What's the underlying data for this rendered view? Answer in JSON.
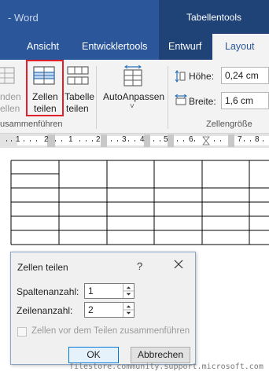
{
  "window": {
    "title": "- Word",
    "context_group": "Tabellentools"
  },
  "tabs": [
    {
      "label": "Ansicht"
    },
    {
      "label": "Entwicklertools"
    },
    {
      "label": "Entwurf"
    },
    {
      "label": "Layout",
      "active": true
    }
  ],
  "ribbon": {
    "merge_group": {
      "partial_button_line1": "nden",
      "partial_button_line2": "ellen",
      "split_cells_line1": "Zellen",
      "split_cells_line2": "teilen",
      "split_table_line1": "Tabelle",
      "split_table_line2": "teilen",
      "group_label": "usammenführen"
    },
    "autofit": {
      "label": "AutoAnpassen",
      "dropdown_glyph": "˅"
    },
    "cell_size": {
      "height_label": "Höhe:",
      "height_value": "0,24 cm",
      "width_label": "Breite:",
      "width_value": "1,6 cm",
      "group_label": "Zellengröße"
    }
  },
  "ruler": {
    "numbers": [
      "1",
      "2",
      "1",
      "2",
      "3",
      "4",
      "5",
      "6",
      "7",
      "8"
    ]
  },
  "dialog": {
    "title": "Zellen teilen",
    "help_glyph": "?",
    "columns_label": "Spaltenanzahl:",
    "columns_value": "1",
    "rows_label": "Zeilenanzahl:",
    "rows_value": "2",
    "merge_checkbox_label": "Zellen vor dem Teilen zusammenführen",
    "merge_checkbox_checked": false,
    "ok_label": "OK",
    "cancel_label": "Abbrechen"
  },
  "watermark": "filestore.community.support.microsoft.com",
  "colors": {
    "word_blue": "#2b579a",
    "context_blue": "#1f4277",
    "highlight_red": "#e0202a"
  }
}
